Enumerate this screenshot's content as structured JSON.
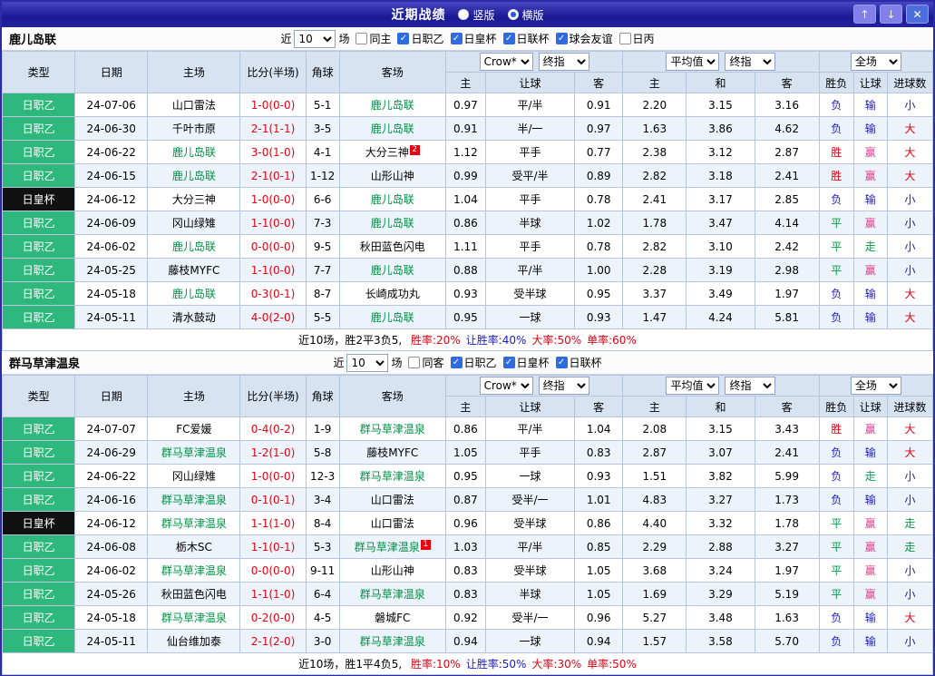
{
  "window": {
    "title": "近期战绩",
    "layout_options": [
      {
        "label": "竖版",
        "selected": false
      },
      {
        "label": "横版",
        "selected": true
      }
    ],
    "buttons": {
      "up": "↑",
      "down": "↓",
      "close": "✕"
    }
  },
  "colors": {
    "league_green": "#2eb87e",
    "score_red": "#e60012",
    "win_red": "#e60012",
    "lose_blue": "#1919cc",
    "draw_green": "#009a45",
    "handicap_win_pink": "#e23a8b",
    "focus_team_green": "#009245",
    "titlebar_blue": "#1a1a94",
    "header_bg": "#d8e3f2"
  },
  "table_header": {
    "cols": [
      "类型",
      "日期",
      "主场",
      "比分(半场)",
      "角球",
      "客场"
    ],
    "odds_group": {
      "selects": [
        "Crow*",
        "终指"
      ],
      "cols": [
        "主",
        "让球",
        "客"
      ]
    },
    "avg_group": {
      "selects": [
        "平均值",
        "终指"
      ],
      "cols": [
        "主",
        "和",
        "客"
      ]
    },
    "result_group": {
      "selects": [
        "全场"
      ],
      "cols": [
        "胜负",
        "让球",
        "进球数"
      ]
    }
  },
  "sections": [
    {
      "team": "鹿儿岛联",
      "filter": {
        "near_label": "近",
        "count": "10",
        "games_label": "场",
        "checkboxes": [
          {
            "label": "同主",
            "checked": false
          },
          {
            "label": "日职乙",
            "checked": true
          },
          {
            "label": "日皇杯",
            "checked": true
          },
          {
            "label": "日联杯",
            "checked": true
          },
          {
            "label": "球会友谊",
            "checked": true
          },
          {
            "label": "日丙",
            "checked": false
          }
        ]
      },
      "rows": [
        {
          "league": "日职乙",
          "league_style": "green",
          "date": "24-07-06",
          "home": "山口雷法",
          "home_focus": false,
          "home_badge": "",
          "score": "1-0(0-0)",
          "corner": "5-1",
          "away": "鹿儿岛联",
          "away_focus": true,
          "away_badge": "",
          "odds": [
            "0.97",
            "平/半",
            "0.91"
          ],
          "avg": [
            "2.20",
            "3.15",
            "3.16"
          ],
          "result": {
            "text": "负",
            "c": "blue"
          },
          "handicap": {
            "text": "输",
            "c": "blue"
          },
          "goals": {
            "text": "小",
            "c": "blue"
          }
        },
        {
          "league": "日职乙",
          "league_style": "green",
          "date": "24-06-30",
          "home": "千叶市原",
          "home_focus": false,
          "home_badge": "",
          "score": "2-1(1-1)",
          "corner": "3-5",
          "away": "鹿儿岛联",
          "away_focus": true,
          "away_badge": "",
          "odds": [
            "0.91",
            "半/一",
            "0.97"
          ],
          "avg": [
            "1.63",
            "3.86",
            "4.62"
          ],
          "result": {
            "text": "负",
            "c": "blue"
          },
          "handicap": {
            "text": "输",
            "c": "blue"
          },
          "goals": {
            "text": "大",
            "c": "red"
          }
        },
        {
          "league": "日职乙",
          "league_style": "green",
          "date": "24-06-22",
          "home": "鹿儿岛联",
          "home_focus": true,
          "home_badge": "",
          "score": "3-0(1-0)",
          "corner": "4-1",
          "away": "大分三神",
          "away_focus": false,
          "away_badge": "2",
          "odds": [
            "1.12",
            "平手",
            "0.77"
          ],
          "avg": [
            "2.38",
            "3.12",
            "2.87"
          ],
          "result": {
            "text": "胜",
            "c": "red"
          },
          "handicap": {
            "text": "赢",
            "c": "pink"
          },
          "goals": {
            "text": "大",
            "c": "red"
          }
        },
        {
          "league": "日职乙",
          "league_style": "green",
          "date": "24-06-15",
          "home": "鹿儿岛联",
          "home_focus": true,
          "home_badge": "",
          "score": "2-1(0-1)",
          "corner": "1-12",
          "away": "山形山神",
          "away_focus": false,
          "away_badge": "",
          "odds": [
            "0.99",
            "受平/半",
            "0.89"
          ],
          "avg": [
            "2.82",
            "3.18",
            "2.41"
          ],
          "result": {
            "text": "胜",
            "c": "red"
          },
          "handicap": {
            "text": "赢",
            "c": "pink"
          },
          "goals": {
            "text": "大",
            "c": "red"
          }
        },
        {
          "league": "日皇杯",
          "league_style": "black",
          "date": "24-06-12",
          "home": "大分三神",
          "home_focus": false,
          "home_badge": "",
          "score": "1-0(0-0)",
          "corner": "6-6",
          "away": "鹿儿岛联",
          "away_focus": true,
          "away_badge": "",
          "odds": [
            "1.04",
            "平手",
            "0.78"
          ],
          "avg": [
            "2.41",
            "3.17",
            "2.85"
          ],
          "result": {
            "text": "负",
            "c": "blue"
          },
          "handicap": {
            "text": "输",
            "c": "blue"
          },
          "goals": {
            "text": "小",
            "c": "blue"
          }
        },
        {
          "league": "日职乙",
          "league_style": "green",
          "date": "24-06-09",
          "home": "冈山绿雉",
          "home_focus": false,
          "home_badge": "",
          "score": "1-1(0-0)",
          "corner": "7-3",
          "away": "鹿儿岛联",
          "away_focus": true,
          "away_badge": "",
          "odds": [
            "0.86",
            "半球",
            "1.02"
          ],
          "avg": [
            "1.78",
            "3.47",
            "4.14"
          ],
          "result": {
            "text": "平",
            "c": "green"
          },
          "handicap": {
            "text": "赢",
            "c": "pink"
          },
          "goals": {
            "text": "小",
            "c": "blue"
          }
        },
        {
          "league": "日职乙",
          "league_style": "green",
          "date": "24-06-02",
          "home": "鹿儿岛联",
          "home_focus": true,
          "home_badge": "",
          "score": "0-0(0-0)",
          "corner": "9-5",
          "away": "秋田蓝色闪电",
          "away_focus": false,
          "away_badge": "",
          "odds": [
            "1.11",
            "平手",
            "0.78"
          ],
          "avg": [
            "2.82",
            "3.10",
            "2.42"
          ],
          "result": {
            "text": "平",
            "c": "green"
          },
          "handicap": {
            "text": "走",
            "c": "green"
          },
          "goals": {
            "text": "小",
            "c": "blue"
          }
        },
        {
          "league": "日职乙",
          "league_style": "green",
          "date": "24-05-25",
          "home": "藤枝MYFC",
          "home_focus": false,
          "home_badge": "",
          "score": "1-1(0-0)",
          "corner": "7-7",
          "away": "鹿儿岛联",
          "away_focus": true,
          "away_badge": "",
          "odds": [
            "0.88",
            "平/半",
            "1.00"
          ],
          "avg": [
            "2.28",
            "3.19",
            "2.98"
          ],
          "result": {
            "text": "平",
            "c": "green"
          },
          "handicap": {
            "text": "赢",
            "c": "pink"
          },
          "goals": {
            "text": "小",
            "c": "blue"
          }
        },
        {
          "league": "日职乙",
          "league_style": "green",
          "date": "24-05-18",
          "home": "鹿儿岛联",
          "home_focus": true,
          "home_badge": "",
          "score": "0-3(0-1)",
          "corner": "8-7",
          "away": "长崎成功丸",
          "away_focus": false,
          "away_badge": "",
          "odds": [
            "0.93",
            "受半球",
            "0.95"
          ],
          "avg": [
            "3.37",
            "3.49",
            "1.97"
          ],
          "result": {
            "text": "负",
            "c": "blue"
          },
          "handicap": {
            "text": "输",
            "c": "blue"
          },
          "goals": {
            "text": "大",
            "c": "red"
          }
        },
        {
          "league": "日职乙",
          "league_style": "green",
          "date": "24-05-11",
          "home": "清水鼓动",
          "home_focus": false,
          "home_badge": "",
          "score": "4-0(2-0)",
          "corner": "5-5",
          "away": "鹿儿岛联",
          "away_focus": true,
          "away_badge": "",
          "odds": [
            "0.95",
            "一球",
            "0.93"
          ],
          "avg": [
            "1.47",
            "4.24",
            "5.81"
          ],
          "result": {
            "text": "负",
            "c": "blue"
          },
          "handicap": {
            "text": "输",
            "c": "blue"
          },
          "goals": {
            "text": "大",
            "c": "red"
          }
        }
      ],
      "summary": {
        "prefix": "近10场，胜2平3负5, ",
        "stats": [
          {
            "text": "胜率:20%",
            "c": "red"
          },
          {
            "text": "让胜率:40%",
            "c": "blue"
          },
          {
            "text": "大率:50%",
            "c": "red"
          },
          {
            "text": "单率:60%",
            "c": "red"
          }
        ]
      }
    },
    {
      "team": "群马草津温泉",
      "filter": {
        "near_label": "近",
        "count": "10",
        "games_label": "场",
        "checkboxes": [
          {
            "label": "同客",
            "checked": false
          },
          {
            "label": "日职乙",
            "checked": true
          },
          {
            "label": "日皇杯",
            "checked": true
          },
          {
            "label": "日联杯",
            "checked": true
          }
        ]
      },
      "rows": [
        {
          "league": "日职乙",
          "league_style": "green",
          "date": "24-07-07",
          "home": "FC爱媛",
          "home_focus": false,
          "home_badge": "",
          "score": "0-4(0-2)",
          "corner": "1-9",
          "away": "群马草津温泉",
          "away_focus": true,
          "away_badge": "",
          "odds": [
            "0.86",
            "平/半",
            "1.04"
          ],
          "avg": [
            "2.08",
            "3.15",
            "3.43"
          ],
          "result": {
            "text": "胜",
            "c": "red"
          },
          "handicap": {
            "text": "赢",
            "c": "pink"
          },
          "goals": {
            "text": "大",
            "c": "red"
          }
        },
        {
          "league": "日职乙",
          "league_style": "green",
          "date": "24-06-29",
          "home": "群马草津温泉",
          "home_focus": true,
          "home_badge": "",
          "score": "1-2(1-0)",
          "corner": "5-8",
          "away": "藤枝MYFC",
          "away_focus": false,
          "away_badge": "",
          "odds": [
            "1.05",
            "平手",
            "0.83"
          ],
          "avg": [
            "2.87",
            "3.07",
            "2.41"
          ],
          "result": {
            "text": "负",
            "c": "blue"
          },
          "handicap": {
            "text": "输",
            "c": "blue"
          },
          "goals": {
            "text": "大",
            "c": "red"
          }
        },
        {
          "league": "日职乙",
          "league_style": "green",
          "date": "24-06-22",
          "home": "冈山绿雉",
          "home_focus": false,
          "home_badge": "",
          "score": "1-0(0-0)",
          "corner": "12-3",
          "away": "群马草津温泉",
          "away_focus": true,
          "away_badge": "",
          "odds": [
            "0.95",
            "一球",
            "0.93"
          ],
          "avg": [
            "1.51",
            "3.82",
            "5.99"
          ],
          "result": {
            "text": "负",
            "c": "blue"
          },
          "handicap": {
            "text": "走",
            "c": "green"
          },
          "goals": {
            "text": "小",
            "c": "blue"
          }
        },
        {
          "league": "日职乙",
          "league_style": "green",
          "date": "24-06-16",
          "home": "群马草津温泉",
          "home_focus": true,
          "home_badge": "",
          "score": "0-1(0-1)",
          "corner": "3-4",
          "away": "山口雷法",
          "away_focus": false,
          "away_badge": "",
          "odds": [
            "0.87",
            "受半/一",
            "1.01"
          ],
          "avg": [
            "4.83",
            "3.27",
            "1.73"
          ],
          "result": {
            "text": "负",
            "c": "blue"
          },
          "handicap": {
            "text": "输",
            "c": "blue"
          },
          "goals": {
            "text": "小",
            "c": "blue"
          }
        },
        {
          "league": "日皇杯",
          "league_style": "black",
          "date": "24-06-12",
          "home": "群马草津温泉",
          "home_focus": true,
          "home_badge": "",
          "score": "1-1(1-0)",
          "corner": "8-4",
          "away": "山口雷法",
          "away_focus": false,
          "away_badge": "",
          "odds": [
            "0.96",
            "受半球",
            "0.86"
          ],
          "avg": [
            "4.40",
            "3.32",
            "1.78"
          ],
          "result": {
            "text": "平",
            "c": "green"
          },
          "handicap": {
            "text": "赢",
            "c": "pink"
          },
          "goals": {
            "text": "走",
            "c": "green"
          }
        },
        {
          "league": "日职乙",
          "league_style": "green",
          "date": "24-06-08",
          "home": "栃木SC",
          "home_focus": false,
          "home_badge": "",
          "score": "1-1(0-1)",
          "corner": "5-3",
          "away": "群马草津温泉",
          "away_focus": true,
          "away_badge": "1",
          "odds": [
            "1.03",
            "平/半",
            "0.85"
          ],
          "avg": [
            "2.29",
            "2.88",
            "3.27"
          ],
          "result": {
            "text": "平",
            "c": "green"
          },
          "handicap": {
            "text": "赢",
            "c": "pink"
          },
          "goals": {
            "text": "走",
            "c": "green"
          }
        },
        {
          "league": "日职乙",
          "league_style": "green",
          "date": "24-06-02",
          "home": "群马草津温泉",
          "home_focus": true,
          "home_badge": "",
          "score": "0-0(0-0)",
          "corner": "9-11",
          "away": "山形山神",
          "away_focus": false,
          "away_badge": "",
          "odds": [
            "0.83",
            "受半球",
            "1.05"
          ],
          "avg": [
            "3.68",
            "3.24",
            "1.97"
          ],
          "result": {
            "text": "平",
            "c": "green"
          },
          "handicap": {
            "text": "赢",
            "c": "pink"
          },
          "goals": {
            "text": "小",
            "c": "blue"
          }
        },
        {
          "league": "日职乙",
          "league_style": "green",
          "date": "24-05-26",
          "home": "秋田蓝色闪电",
          "home_focus": false,
          "home_badge": "",
          "score": "1-1(1-0)",
          "corner": "6-4",
          "away": "群马草津温泉",
          "away_focus": true,
          "away_badge": "",
          "odds": [
            "0.83",
            "半球",
            "1.05"
          ],
          "avg": [
            "1.69",
            "3.29",
            "5.19"
          ],
          "result": {
            "text": "平",
            "c": "green"
          },
          "handicap": {
            "text": "赢",
            "c": "pink"
          },
          "goals": {
            "text": "小",
            "c": "blue"
          }
        },
        {
          "league": "日职乙",
          "league_style": "green",
          "date": "24-05-18",
          "home": "群马草津温泉",
          "home_focus": true,
          "home_badge": "",
          "score": "0-2(0-0)",
          "corner": "4-5",
          "away": "磐城FC",
          "away_focus": false,
          "away_badge": "",
          "odds": [
            "0.92",
            "受半/一",
            "0.96"
          ],
          "avg": [
            "5.27",
            "3.48",
            "1.63"
          ],
          "result": {
            "text": "负",
            "c": "blue"
          },
          "handicap": {
            "text": "输",
            "c": "blue"
          },
          "goals": {
            "text": "大",
            "c": "red"
          }
        },
        {
          "league": "日职乙",
          "league_style": "green",
          "date": "24-05-11",
          "home": "仙台维加泰",
          "home_focus": false,
          "home_badge": "",
          "score": "2-1(2-0)",
          "corner": "3-0",
          "away": "群马草津温泉",
          "away_focus": true,
          "away_badge": "",
          "odds": [
            "0.94",
            "一球",
            "0.94"
          ],
          "avg": [
            "1.57",
            "3.58",
            "5.70"
          ],
          "result": {
            "text": "负",
            "c": "blue"
          },
          "handicap": {
            "text": "输",
            "c": "blue"
          },
          "goals": {
            "text": "小",
            "c": "blue"
          }
        }
      ],
      "summary": {
        "prefix": "近10场，胜1平4负5, ",
        "stats": [
          {
            "text": "胜率:10%",
            "c": "red"
          },
          {
            "text": "让胜率:50%",
            "c": "blue"
          },
          {
            "text": "大率:30%",
            "c": "red"
          },
          {
            "text": "单率:50%",
            "c": "red"
          }
        ]
      }
    }
  ]
}
